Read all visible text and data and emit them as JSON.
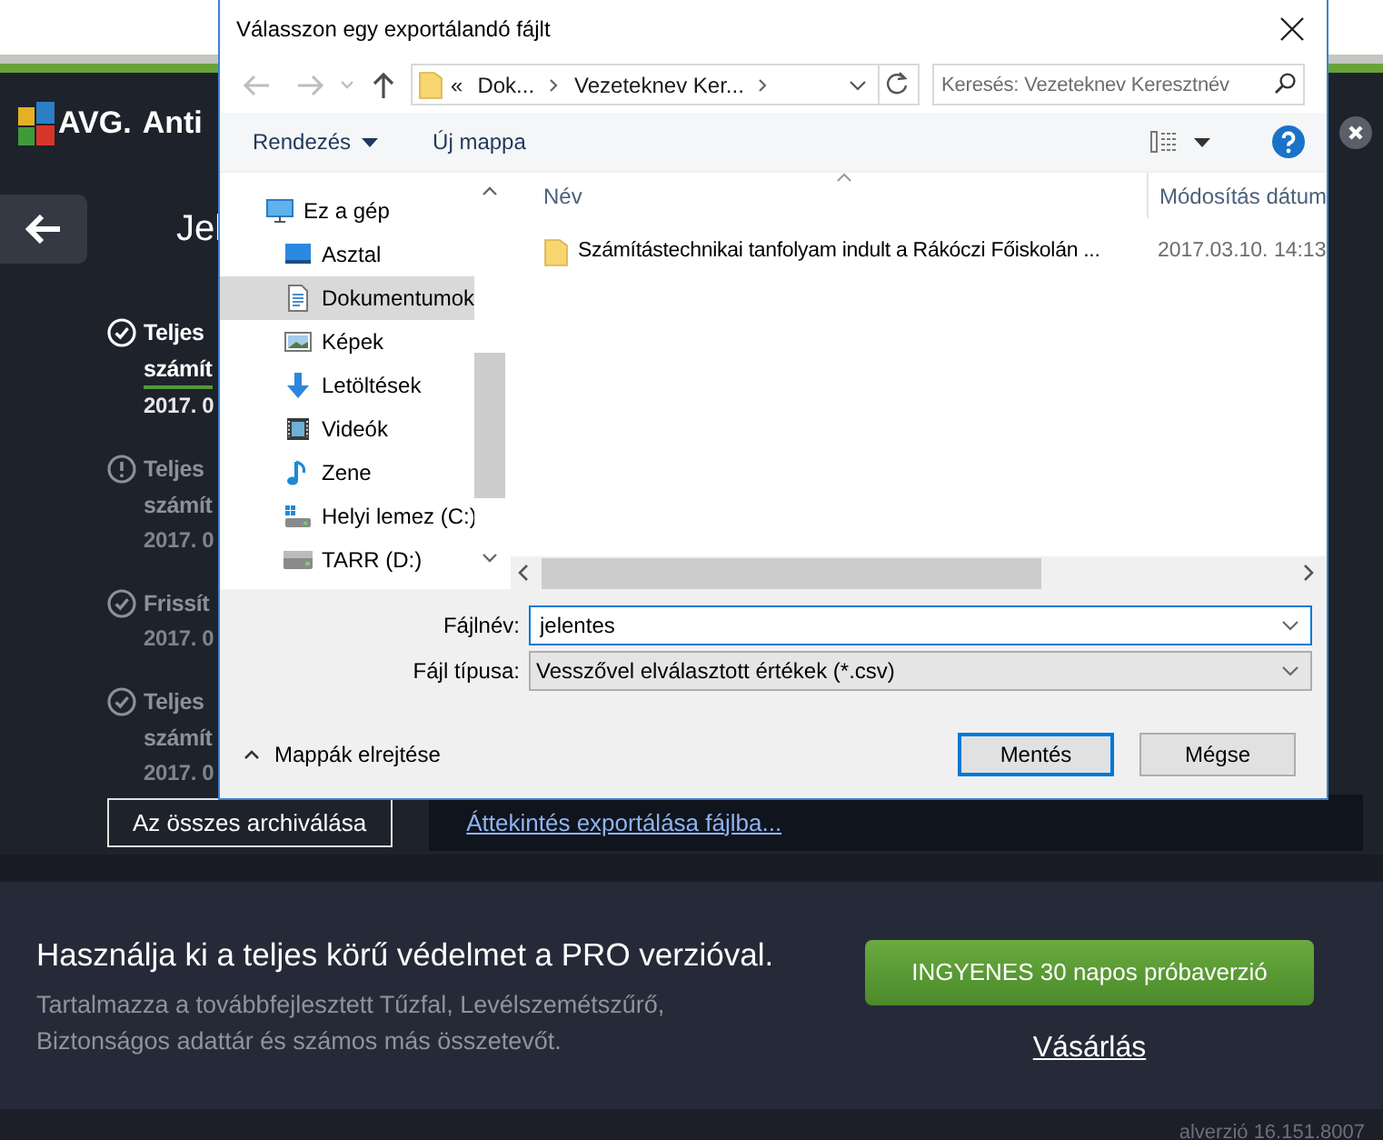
{
  "app": {
    "logo": "AVG.",
    "title": "Anti",
    "heading": "Jel",
    "reports": [
      {
        "kind": "ok",
        "selected": true,
        "lines": [
          "Teljes",
          "számít"
        ],
        "date": "2017. 0"
      },
      {
        "kind": "warning",
        "selected": false,
        "lines": [
          "Teljes",
          "számít"
        ],
        "date": "2017. 0"
      },
      {
        "kind": "ok",
        "selected": false,
        "lines": [
          "Frissít"
        ],
        "date": "2017. 0"
      },
      {
        "kind": "ok",
        "selected": false,
        "lines": [
          "Teljes",
          "számít"
        ],
        "date": "2017. 0"
      }
    ],
    "archive_button": "Az összes archiválása",
    "export_link": "Áttekintés exportálása fájlba...",
    "promo": {
      "heading": "Használja ki a teljes körű védelmet a PRO verzióval.",
      "description": "Tartalmazza a továbbfejlesztett Tűzfal, Levélszemétszűrő, Biztonságos adattár és számos más összetevőt.",
      "trial_button": "INGYENES 30 napos próbaverzió",
      "buy_link": "Vásárlás"
    },
    "version": "alverzió 16.151.8007"
  },
  "dialog": {
    "title": "Válasszon egy exportálandó fájlt",
    "breadcrumb": [
      "«",
      "Dok...",
      "Vezeteknev Ker..."
    ],
    "search": {
      "placeholder": "Keresés: Vezeteknev Keresztnév"
    },
    "toolbar": [
      "Rendezés",
      "Új mappa"
    ],
    "nav": [
      {
        "label": "Ez a gép",
        "kind": "computer",
        "selected": false,
        "children": [
          {
            "label": "Asztal",
            "kind": "desktop",
            "selected": false
          },
          {
            "label": "Dokumentumok",
            "kind": "documents",
            "selected": true
          },
          {
            "label": "Képek",
            "kind": "pictures",
            "selected": false
          },
          {
            "label": "Letöltések",
            "kind": "downloads",
            "selected": false
          },
          {
            "label": "Videók",
            "kind": "videos",
            "selected": false
          },
          {
            "label": "Zene",
            "kind": "music",
            "selected": false
          },
          {
            "label": "Helyi lemez (C:)",
            "kind": "system-drive",
            "selected": false
          },
          {
            "label": "TARR (D:)",
            "kind": "drive",
            "selected": false
          }
        ]
      }
    ],
    "columns": [
      "Név",
      "Módosítás dátum"
    ],
    "files": [
      {
        "name": "Számítástechnikai tanfolyam indult a Rákóczi Főiskolán ...",
        "modified": "2017.03.10. 14:13"
      }
    ],
    "filename": {
      "label": "Fájlnév:",
      "value": "jelentes"
    },
    "filetype": {
      "label": "Fájl típusa:",
      "value": "Vesszővel elválasztott értékek (*.csv)"
    },
    "hide_folders": "Mappák elrejtése",
    "buttons": [
      {
        "label": "Mentés",
        "default": true
      },
      {
        "label": "Mégse",
        "default": false
      }
    ]
  }
}
